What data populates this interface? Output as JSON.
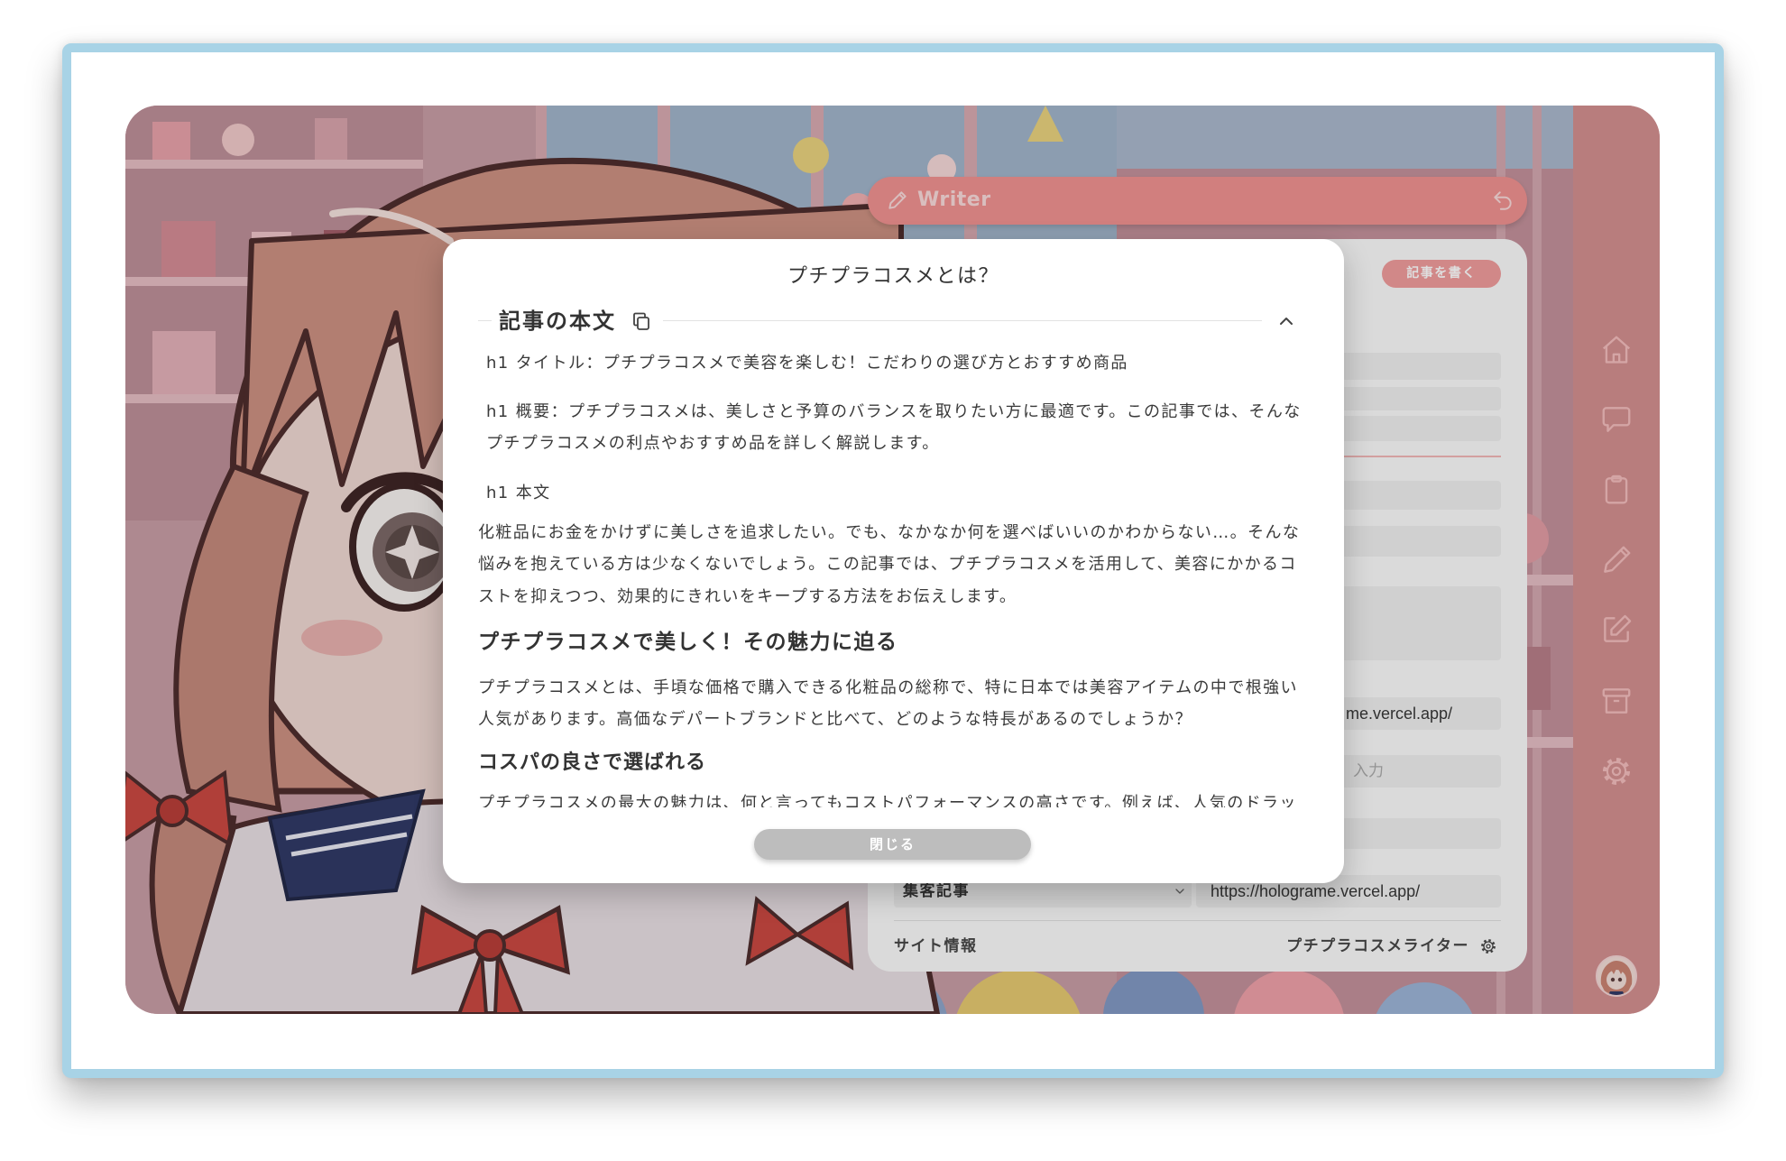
{
  "header": {
    "title": "Writer",
    "left_icon": "pencil-icon",
    "right_icon": "undo-icon"
  },
  "card": {
    "write_button": "記事を書く",
    "url_field_visible": "me.vercel.app/",
    "input_placeholder_visible": "入力",
    "article_type_select": "集客記事",
    "site_url": "https://holograme.vercel.app/",
    "footer_left": "サイト情報",
    "footer_right": "プチプラコスメライター",
    "footer_icon": "gear-icon"
  },
  "sidebar": {
    "items": [
      {
        "icon": "home-icon"
      },
      {
        "icon": "chat-icon"
      },
      {
        "icon": "clipboard-icon"
      },
      {
        "icon": "pencil-icon"
      },
      {
        "icon": "edit-icon"
      },
      {
        "icon": "archive-icon"
      },
      {
        "icon": "gear-icon"
      }
    ],
    "avatar": "user-avatar"
  },
  "modal": {
    "title": "プチプラコスメとは？",
    "section_title": "記事の本文",
    "section_icons": [
      "copy-icon",
      "chevron-up-icon"
    ],
    "body": {
      "h1_title": "h1 タイトル：プチプラコスメで美容を楽しむ！こだわりの選び方とおすすめ商品",
      "summary_lines": [
        "h1 概要：プチプラコスメは、美しさと予算のバランスを取りたい方に最適です。この記事では、そんな",
        "プチプラコスメの利点やおすすめ品を詳しく解説します。"
      ],
      "body_label": "h1 本文",
      "intro_lines": [
        "化粧品にお金をかけずに美しさを追求したい。でも、なかなか何を選べばいいのかわからない…。そんな",
        "悩みを抱えている方は少なくないでしょう。この記事では、プチプラコスメを活用して、美容にかかるコ",
        "ストを抑えつつ、効果的にきれいをキープする方法をお伝えします。"
      ],
      "h2": "プチプラコスメで美しく！その魅力に迫る",
      "h2_lines": [
        "プチプラコスメとは、手頃な価格で購入できる化粧品の総称で、特に日本では美容アイテムの中で根強い",
        "人気があります。高価なデパートブランドと比べて、どのような特長があるのでしょうか？"
      ],
      "h3": "コスパの良さで選ばれる",
      "h3_lines": [
        "プチプラコスメの最大の魅力は、何と言ってもコストパフォーマンスの高さです。例えば、人気のドラッ"
      ]
    },
    "close_button": "閉じる"
  },
  "colors": {
    "accent": "#f0908f",
    "sidebar": "#d38d8d",
    "frame_border": "#a8d3e6",
    "close_button": "#bdbdbd",
    "modal_background": "#ffffff"
  }
}
